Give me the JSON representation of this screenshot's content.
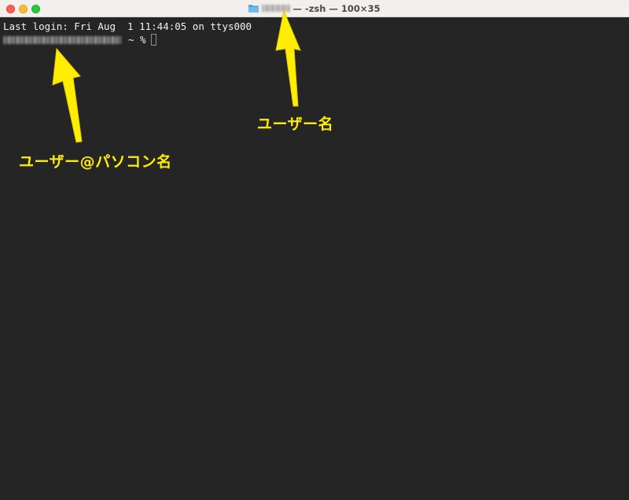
{
  "window": {
    "title_suffix": "— -zsh — 100×35"
  },
  "terminal": {
    "last_login": "Last login: Fri Aug  1 11:44:05 on ttys000",
    "prompt_suffix": "~ %"
  },
  "annotations": {
    "user_name_label": "ユーザー名",
    "user_host_label": "ユーザー@パソコン名",
    "color": "#ffee00"
  },
  "colors": {
    "terminal_bg": "#252525",
    "titlebar_bg": "#f2efed",
    "close": "#fe5f57",
    "minimize": "#febc2e",
    "zoom": "#28c840",
    "folder": "#4aa3df"
  }
}
